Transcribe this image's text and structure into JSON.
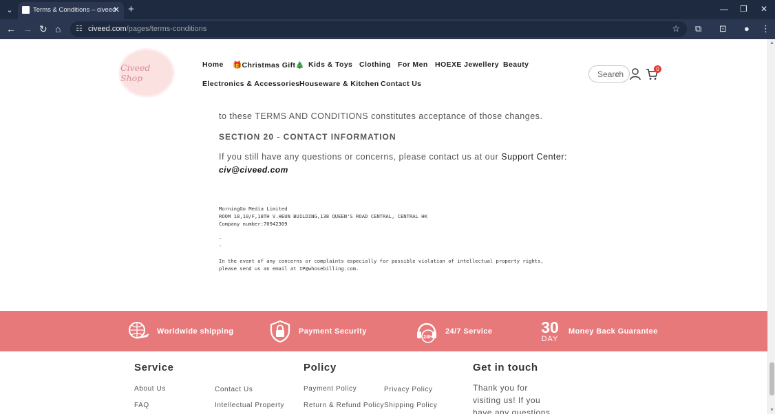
{
  "browser": {
    "tab_title": "Terms & Conditions – civeed",
    "url_host": "civeed.com",
    "url_path": "/pages/terms-conditions"
  },
  "site": {
    "logo_text": "Civeed Shop",
    "nav_row1": [
      "Home",
      "🎁Christmas Gift🎄",
      "Kids & Toys",
      "Clothing",
      "For Men",
      "HOEXE Jewellery",
      "Beauty"
    ],
    "nav_row2": [
      "Electronics & Accessories",
      "Houseware & Kitchen",
      "Contact Us"
    ],
    "search_placeholder": "Search",
    "cart_count": "0"
  },
  "content": {
    "line_changes": "to these TERMS AND CONDITIONS constitutes acceptance of those changes.",
    "section20_heading": "SECTION 20 - CONTACT INFORMATION",
    "contact_text": "If you still have any questions or concerns, please contact us at our",
    "support_label": "Support Center:",
    "email": "civ@civeed.com",
    "company_lines": [
      "MorningGo Media Limited",
      "ROOM 18,10/F,18TH V.HEUN BUILDING,138 QUEEN'S ROAD CENTRAL, CENTRAL HK",
      "Company number:70942309"
    ],
    "dash_lines": [
      "-",
      "-"
    ],
    "ip_lines": [
      "In the event of any concerns or complaints especially for possible violation of intellectual property rights,",
      "please send us an email at IP@whosebilling.com."
    ]
  },
  "band": {
    "items": [
      "Worldwide shipping",
      "Payment Security",
      "24/7 Service",
      "Money Back Guarantee"
    ],
    "day_icon_number": "30",
    "day_icon_word": "DAY",
    "service_icon_text": "24H"
  },
  "footer": {
    "service_heading": "Service",
    "service_links": [
      "About Us",
      "Contact Us",
      "FAQ",
      "Intellectual Property"
    ],
    "policy_heading": "Policy",
    "policy_links": [
      "Payment Policy",
      "Privacy Policy",
      "Return & Refund Policy",
      "Shipping Policy"
    ],
    "touch_heading": "Get in touch",
    "touch_text": "Thank you for visiting us! If you have any questions about our"
  },
  "colors": {
    "band": "#e8797a",
    "chrome_dark": "#1e2a40",
    "chrome_toolbar": "#2b3650",
    "badge": "#e53935"
  }
}
